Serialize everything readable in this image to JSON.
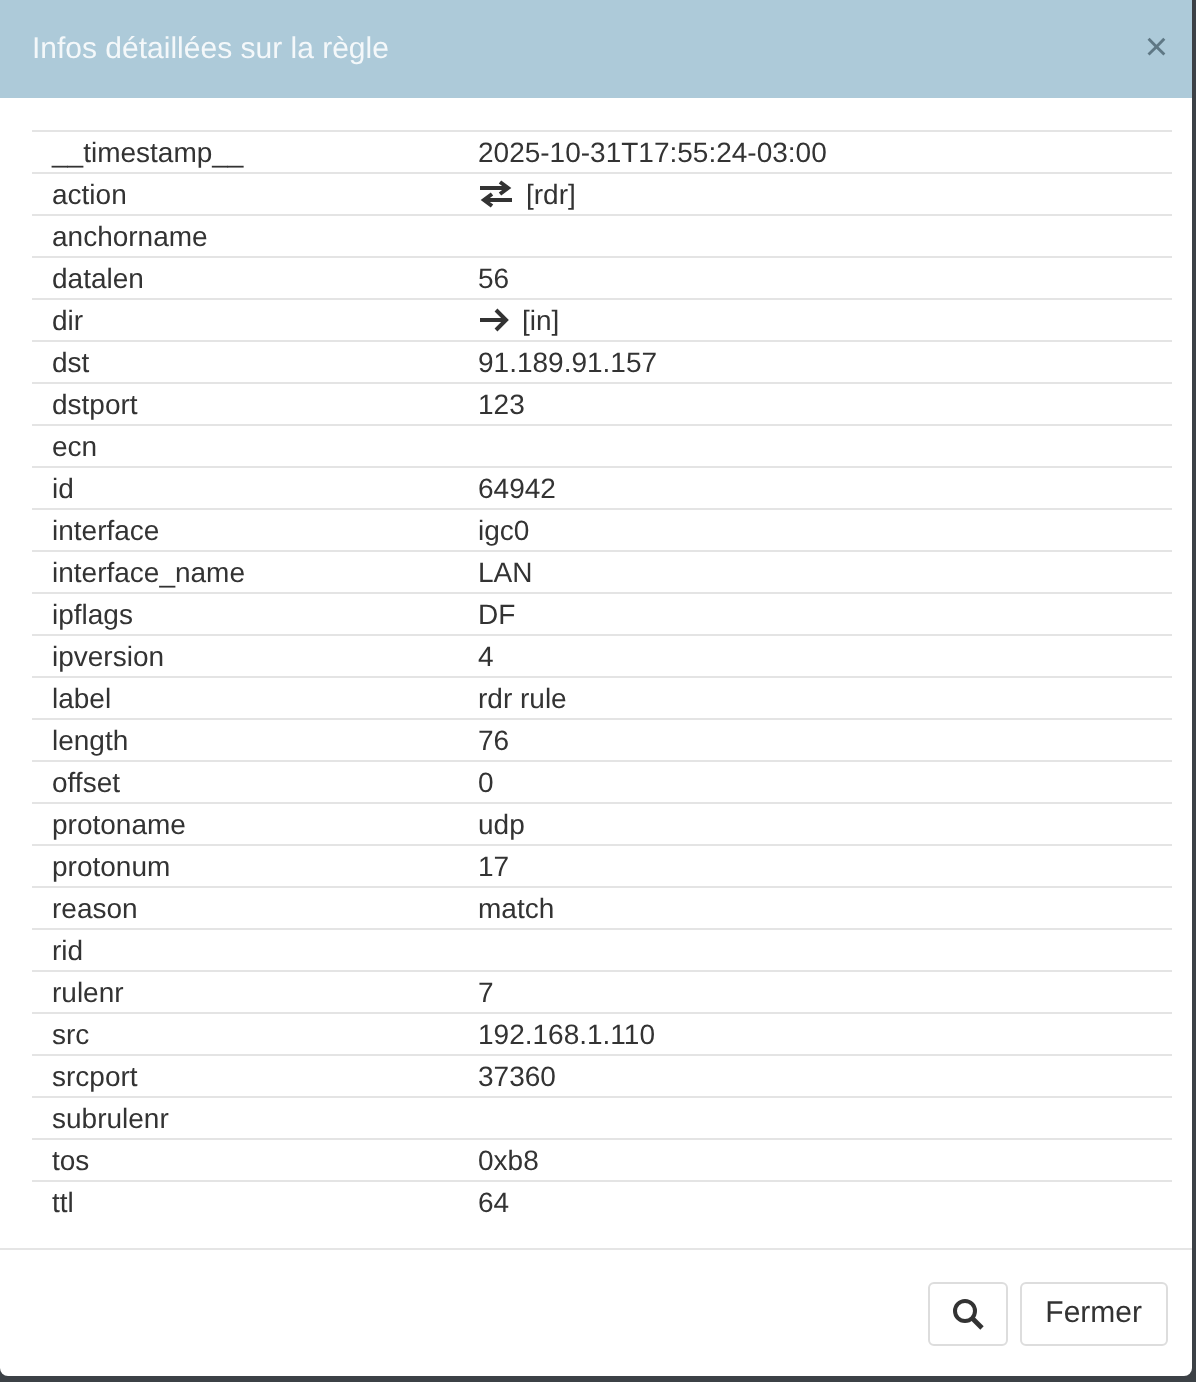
{
  "dialog": {
    "title": "Infos détaillées sur la règle",
    "close": "×"
  },
  "rows": [
    {
      "key": "__timestamp__",
      "value": "2025-10-31T17:55:24-03:00",
      "kind": "plain"
    },
    {
      "key": "action",
      "value": "[rdr]",
      "kind": "swap"
    },
    {
      "key": "anchorname"
    },
    {
      "key": "datalen",
      "value": "56",
      "kind": "plain"
    },
    {
      "key": "dir",
      "value": "[in]",
      "kind": "arrow"
    },
    {
      "key": "dst",
      "value": "91.189.91.157",
      "kind": "plain"
    },
    {
      "key": "dstport",
      "value": "123",
      "kind": "plain"
    },
    {
      "key": "ecn"
    },
    {
      "key": "id",
      "value": "64942",
      "kind": "plain"
    },
    {
      "key": "interface",
      "value": "igc0",
      "kind": "plain"
    },
    {
      "key": "interface_name",
      "value": "LAN",
      "kind": "plain"
    },
    {
      "key": "ipflags",
      "value": "DF",
      "kind": "plain"
    },
    {
      "key": "ipversion",
      "value": "4",
      "kind": "plain"
    },
    {
      "key": "label",
      "value": "rdr rule",
      "kind": "plain"
    },
    {
      "key": "length",
      "value": "76",
      "kind": "plain"
    },
    {
      "key": "offset",
      "value": "0",
      "kind": "plain"
    },
    {
      "key": "protoname",
      "value": "udp",
      "kind": "plain"
    },
    {
      "key": "protonum",
      "value": "17",
      "kind": "plain"
    },
    {
      "key": "reason",
      "value": "match",
      "kind": "plain"
    },
    {
      "key": "rid"
    },
    {
      "key": "rulenr",
      "value": "7",
      "kind": "plain"
    },
    {
      "key": "src",
      "value": "192.168.1.110",
      "kind": "plain"
    },
    {
      "key": "srcport",
      "value": "37360",
      "kind": "plain"
    },
    {
      "key": "subrulenr"
    },
    {
      "key": "tos",
      "value": "0xb8",
      "kind": "plain"
    },
    {
      "key": "ttl",
      "value": "64",
      "kind": "plain"
    }
  ],
  "footer": {
    "close_button": "Fermer"
  }
}
